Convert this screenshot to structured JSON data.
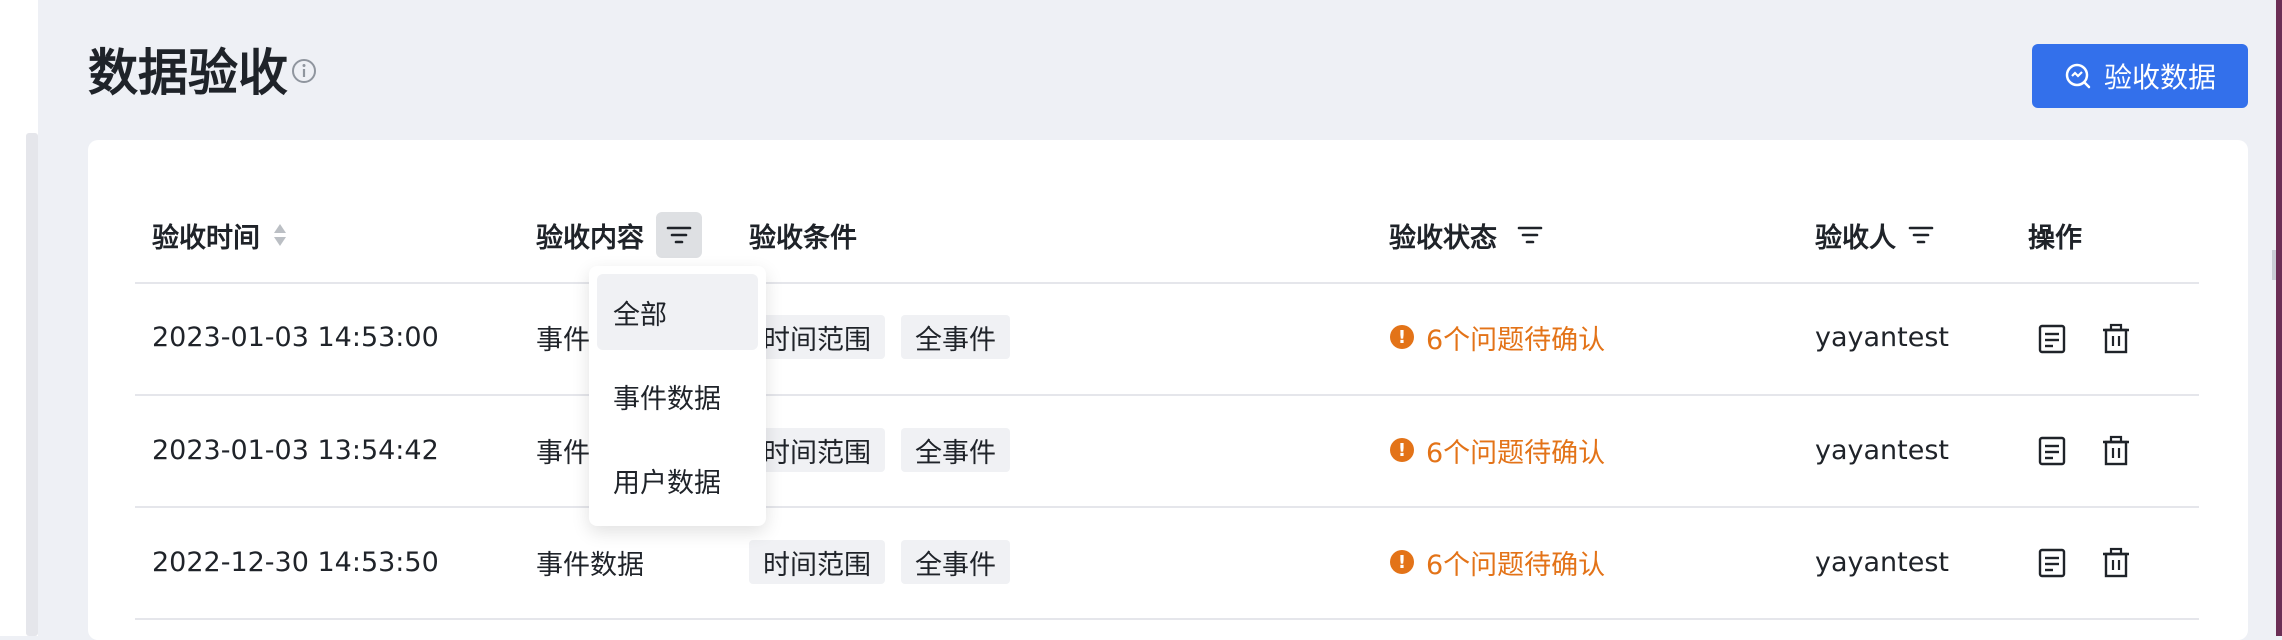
{
  "page": {
    "title": "数据验收",
    "primary_button": "验收数据"
  },
  "table": {
    "headers": {
      "time": "验收时间",
      "content": "验收内容",
      "conditions": "验收条件",
      "status": "验收状态",
      "acceptor": "验收人",
      "actions": "操作"
    },
    "rows": [
      {
        "time": "2023-01-03 14:53:00",
        "content": "事件数据",
        "conditions": [
          "时间范围",
          "全事件"
        ],
        "status": "6个问题待确认",
        "acceptor": "yayantest"
      },
      {
        "time": "2023-01-03 13:54:42",
        "content": "事件数据",
        "conditions": [
          "时间范围",
          "全事件"
        ],
        "status": "6个问题待确认",
        "acceptor": "yayantest"
      },
      {
        "time": "2022-12-30 14:53:50",
        "content": "事件数据",
        "conditions": [
          "时间范围",
          "全事件"
        ],
        "status": "6个问题待确认",
        "acceptor": "yayantest"
      }
    ]
  },
  "filter_dropdown": {
    "options": [
      "全部",
      "事件数据",
      "用户数据"
    ],
    "selected": "全部"
  },
  "colors": {
    "primary": "#3370eb",
    "warning": "#e37318",
    "background": "#eef0f5"
  },
  "icons": {
    "info": "info-icon",
    "search_data": "search-data-icon",
    "sort": "sort-icon",
    "filter": "filter-icon",
    "detail": "document-icon",
    "delete": "trash-icon",
    "warning": "warning-icon"
  }
}
